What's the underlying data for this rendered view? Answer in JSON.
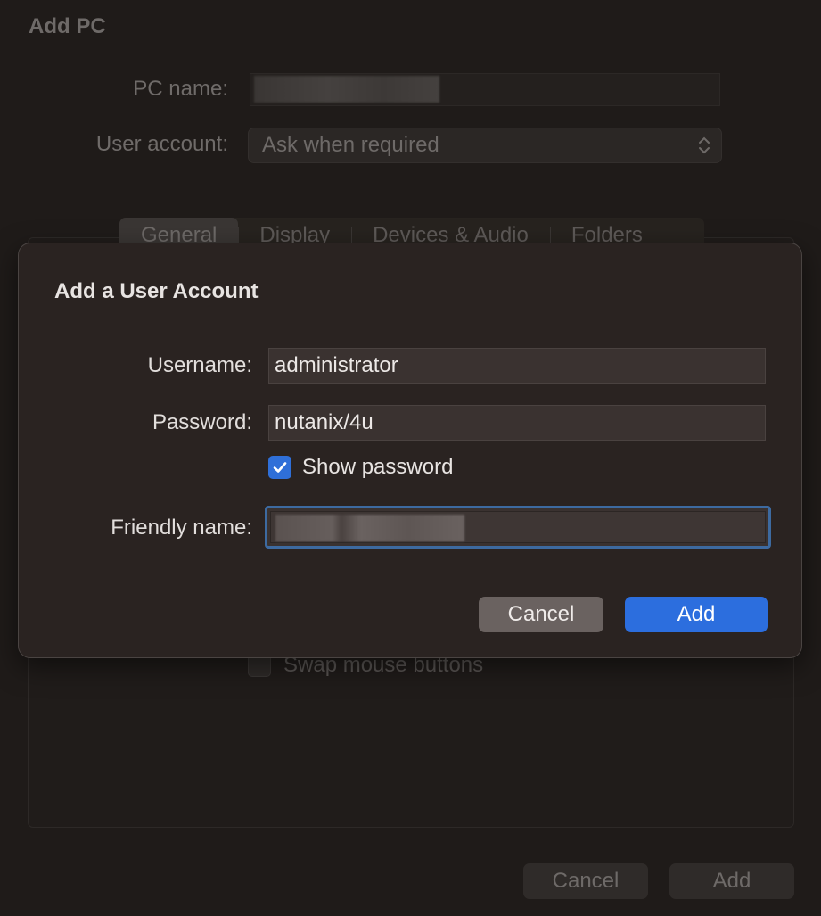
{
  "background_window": {
    "title": "Add PC",
    "pc_name_label": "PC name:",
    "user_account_label": "User account:",
    "user_account_value": "Ask when required",
    "tabs": [
      {
        "label": "General"
      },
      {
        "label": "Display"
      },
      {
        "label": "Devices & Audio"
      },
      {
        "label": "Folders"
      }
    ],
    "swap_mouse_label": "Swap mouse buttons",
    "cancel_label": "Cancel",
    "add_label": "Add"
  },
  "sheet": {
    "title": "Add a User Account",
    "username_label": "Username:",
    "username_value": "administrator",
    "password_label": "Password:",
    "password_value": "nutanix/4u",
    "show_password_label": "Show password",
    "show_password_checked": true,
    "friendly_name_label": "Friendly name:",
    "cancel_label": "Cancel",
    "add_label": "Add"
  },
  "colors": {
    "accent": "#2c6ede",
    "focus_ring": "#3d6aa0",
    "sheet_bg": "#2a2321"
  }
}
